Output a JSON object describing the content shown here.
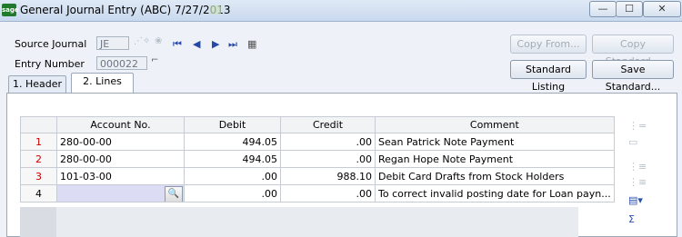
{
  "window": {
    "logo": "sage",
    "title": "General Journal Entry (ABC) 7/27/2013",
    "controls": {
      "minimize": "—",
      "maximize": "☐",
      "close": "✕"
    }
  },
  "header": {
    "source_journal_label": "Source Journal",
    "source_journal_value": "JE",
    "entry_number_label": "Entry Number",
    "entry_number_value": "000022",
    "buttons": {
      "copy_from": "Copy From...",
      "copy_standard": "Copy Standard...",
      "standard_listing": "Standard Listing",
      "save_standard": "Save Standard..."
    }
  },
  "tabs": [
    {
      "label": "1. Header",
      "active": false
    },
    {
      "label": "2. Lines",
      "active": true
    }
  ],
  "grid": {
    "columns": [
      "Account No.",
      "Debit",
      "Credit",
      "Comment"
    ],
    "rows": [
      {
        "num": "1",
        "account": "280-00-00",
        "debit": "494.05",
        "credit": ".00",
        "comment": "Sean Patrick Note Payment"
      },
      {
        "num": "2",
        "account": "280-00-00",
        "debit": "494.05",
        "credit": ".00",
        "comment": "Regan Hope Note Payment"
      },
      {
        "num": "3",
        "account": "101-03-00",
        "debit": ".00",
        "credit": "988.10",
        "comment": "Debit Card Drafts from Stock Holders"
      },
      {
        "num": "4",
        "account": "",
        "debit": ".00",
        "credit": ".00",
        "comment": "To correct invalid posting date for Loan payn..."
      }
    ]
  },
  "colors": {
    "accent": "#2447a8",
    "row_number": "#cc0000",
    "edit_cell": "#dcdcf4"
  }
}
